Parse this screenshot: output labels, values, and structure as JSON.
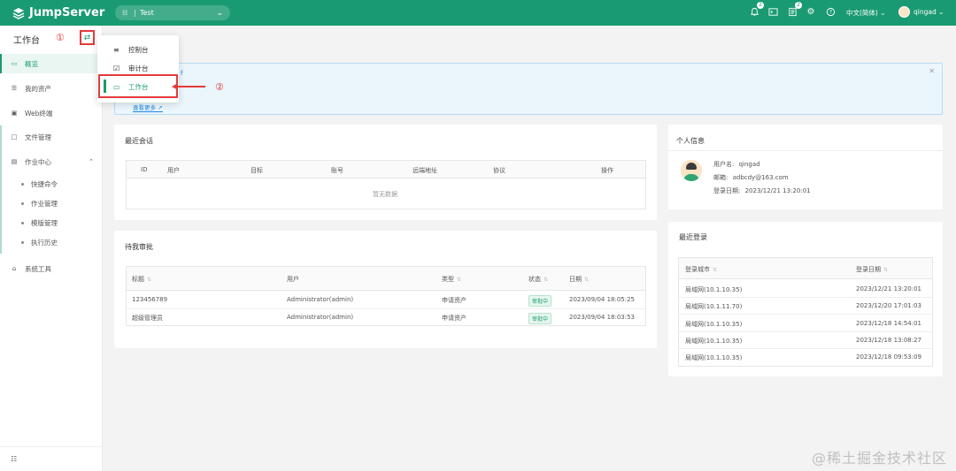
{
  "brand": {
    "name": "JumpServer"
  },
  "org_selector": {
    "icon": "org-icon",
    "label": "Test"
  },
  "topbar": {
    "notifications_badge": "2",
    "tickets_badge": "2",
    "language": "中文(简体)",
    "username": "qingad"
  },
  "sidebar": {
    "title": "工作台",
    "items": [
      {
        "label": "概览",
        "icon": "monitor-icon"
      },
      {
        "label": "我的资产",
        "icon": "server-icon"
      },
      {
        "label": "Web终端",
        "icon": "terminal-icon"
      },
      {
        "label": "文件管理",
        "icon": "file-icon"
      },
      {
        "label": "作业中心",
        "icon": "job-icon"
      },
      {
        "label": "系统工具",
        "icon": "toolbox-icon"
      }
    ],
    "job_subitems": [
      "快捷命令",
      "作业管理",
      "模版管理",
      "执行历史"
    ]
  },
  "annotations": {
    "one": "①",
    "two": "②"
  },
  "view_switch_menu": {
    "items": [
      {
        "label": "控制台",
        "icon": "settings-sliders-icon"
      },
      {
        "label": "审计台",
        "icon": "audit-check-icon"
      },
      {
        "label": "工作台",
        "icon": "workbench-monitor-icon"
      }
    ]
  },
  "banner": {
    "text_fragment": "f",
    "more_link": "查看更多"
  },
  "recent_sessions": {
    "title": "最近会话",
    "columns": [
      "ID",
      "用户",
      "目标",
      "账号",
      "远端地址",
      "协议",
      "操作"
    ],
    "empty_text": "暂无数据"
  },
  "personal_info": {
    "title": "个人信息",
    "username_label": "用户名:",
    "username": "qingad",
    "email_label": "邮箱:",
    "email": "adbcdy@163.com",
    "login_date_label": "登录日期:",
    "login_date": "2023/12/21 13:20:01"
  },
  "pending_approval": {
    "title": "待我审批",
    "columns": [
      "标题",
      "用户",
      "类型",
      "状态",
      "日期"
    ],
    "rows": [
      {
        "title": "123456789",
        "user": "Administrator(admin)",
        "type": "申请资产",
        "status": "审批中",
        "date": "2023/09/04 18:05:25"
      },
      {
        "title": "超级管理员",
        "user": "Administrator(admin)",
        "type": "申请资产",
        "status": "审批中",
        "date": "2023/09/04 18:03:53"
      }
    ]
  },
  "recent_logins": {
    "title": "最近登录",
    "columns": [
      "登录城市",
      "登录日期"
    ],
    "rows": [
      {
        "city": "局域网(10.1.10.35)",
        "date": "2023/12/21 13:20:01"
      },
      {
        "city": "局域网(10.1.11.70)",
        "date": "2023/12/20 17:01:03"
      },
      {
        "city": "局域网(10.1.10.35)",
        "date": "2023/12/18 14:54:01"
      },
      {
        "city": "局域网(10.1.10.35)",
        "date": "2023/12/18 13:08:27"
      },
      {
        "city": "局域网(10.1.10.35)",
        "date": "2023/12/18 09:53:09"
      }
    ]
  },
  "watermark": "@稀土掘金技术社区"
}
